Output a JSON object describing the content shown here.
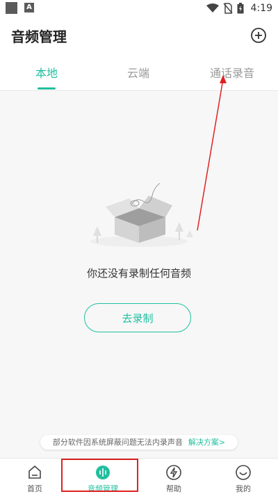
{
  "status_bar": {
    "time": "4:19",
    "app_badge": "A"
  },
  "header": {
    "title": "音频管理"
  },
  "tabs": [
    {
      "label": "本地",
      "active": true
    },
    {
      "label": "云端",
      "active": false
    },
    {
      "label": "通话录音",
      "active": false
    }
  ],
  "empty_state": {
    "message": "你还没有录制任何音频",
    "button_label": "去录制"
  },
  "notice": {
    "text": "部分软件因系统屏蔽问题无法内录声音",
    "link": "解决方案>"
  },
  "bottom_nav": [
    {
      "label": "首页",
      "icon": "home-icon"
    },
    {
      "label": "音频管理",
      "icon": "audio-manage-icon",
      "active": true
    },
    {
      "label": "帮助",
      "icon": "help-icon"
    },
    {
      "label": "我的",
      "icon": "profile-icon"
    }
  ],
  "colors": {
    "accent": "#1fbf9f",
    "annotation": "#e02020"
  }
}
